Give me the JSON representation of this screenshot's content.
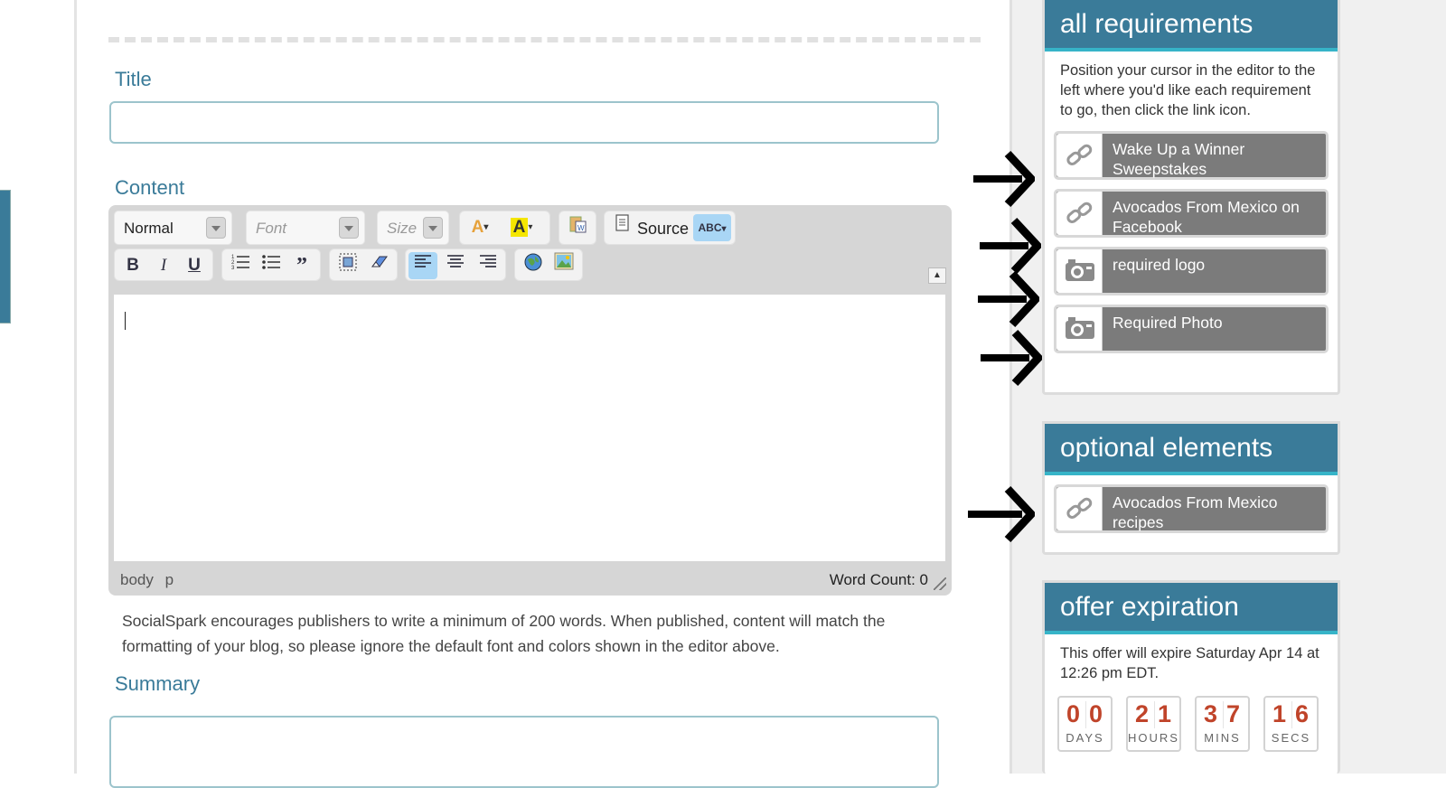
{
  "form": {
    "title_label": "Title",
    "content_label": "Content",
    "summary_label": "Summary"
  },
  "editor": {
    "format_value": "Normal",
    "font_placeholder": "Font",
    "size_placeholder": "Size",
    "source_label": "Source",
    "status_body": "body",
    "status_p": "p",
    "word_count": "Word Count: 0",
    "icons": [
      "text-color-icon",
      "background-color-icon",
      "paste-from-word-icon",
      "source-icon",
      "spellcheck-icon",
      "bold-icon",
      "italic-icon",
      "underline-icon",
      "numbered-list-icon",
      "bulleted-list-icon",
      "blockquote-icon",
      "select-all-icon",
      "remove-format-icon",
      "align-left-icon",
      "align-center-icon",
      "align-right-icon",
      "link-globe-icon",
      "image-icon"
    ]
  },
  "hint": "SocialSpark encourages publishers to write a minimum of 200 words. When published, content will match the formatting of your blog, so please ignore the default font and colors shown in the editor above.",
  "sidebar": {
    "requirements": {
      "title": "all requirements",
      "text": "Position your cursor in the editor to the left where you'd like each requirement to go, then click the link icon.",
      "items": [
        {
          "label": "Wake Up a Winner Sweepstakes",
          "icon": "link-icon"
        },
        {
          "label": "Avocados From Mexico on Facebook",
          "icon": "link-icon"
        },
        {
          "label": "required logo",
          "icon": "camera-icon"
        },
        {
          "label": "Required Photo",
          "icon": "camera-icon"
        }
      ]
    },
    "optional": {
      "title": "optional elements",
      "items": [
        {
          "label": "Avocados From Mexico recipes",
          "icon": "link-icon"
        }
      ]
    },
    "expiration": {
      "title": "offer expiration",
      "text": "This offer will expire Saturday Apr 14 at 12:26 pm EDT.",
      "countdown": [
        {
          "digits": "00",
          "unit": "DAYS"
        },
        {
          "digits": "21",
          "unit": "HOURS"
        },
        {
          "digits": "37",
          "unit": "MINS"
        },
        {
          "digits": "16",
          "unit": "SECS"
        }
      ]
    }
  },
  "colors": {
    "accent": "#3a7b99",
    "accent_stripe": "#36b4c8",
    "countdown_digit": "#c0442a",
    "requirement_bg": "#7b7b7b"
  }
}
